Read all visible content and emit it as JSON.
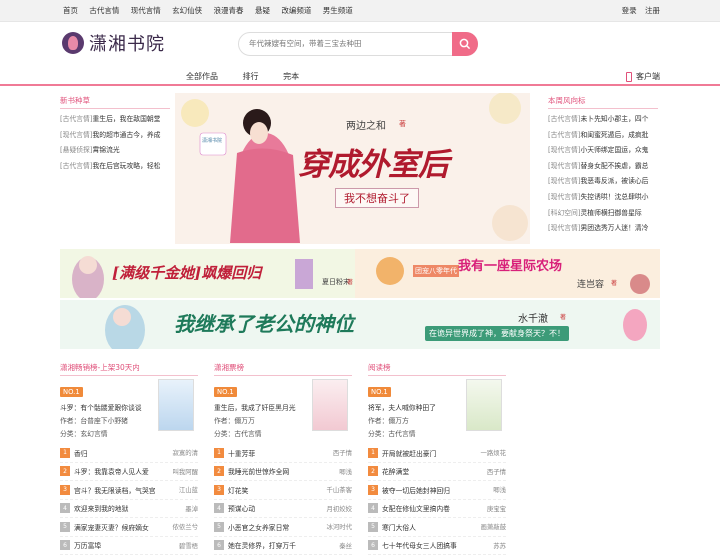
{
  "topbar": {
    "nav": [
      "首页",
      "古代言情",
      "现代言情",
      "玄幻仙侠",
      "浪漫青春",
      "悬疑",
      "改编频道",
      "男生频道"
    ],
    "login": "登录",
    "register": "注册"
  },
  "header": {
    "logo_text": "潇湘书院",
    "search_placeholder": "年代辣嫂有空间，带着三宝去种田"
  },
  "mainnav": {
    "items": [
      "全部作品",
      "排行",
      "完本"
    ],
    "service": "客户端"
  },
  "left": {
    "title": "新书种草",
    "items": [
      {
        "cat": "[古代言情]",
        "text": "重生后，我在敌国朝堂"
      },
      {
        "cat": "[现代言情]",
        "text": "我的超市通古今，养成"
      },
      {
        "cat": "[悬疑侦探]",
        "text": "霄锦流光"
      },
      {
        "cat": "[古代言情]",
        "text": "我在后宫玩攻略，轻松"
      }
    ]
  },
  "right": {
    "title": "本周风向标",
    "items": [
      {
        "cat": "[古代言情]",
        "text": "未卜先知小郡主，四个"
      },
      {
        "cat": "[古代言情]",
        "text": "和闺蜜死遁后，成疯批"
      },
      {
        "cat": "[现代言情]",
        "text": "小天师绑定国运，众鬼"
      },
      {
        "cat": "[现代言情]",
        "text": "替身女配不挨虐，霸总"
      },
      {
        "cat": "[现代言情]",
        "text": "我恶毒反派，被读心后"
      },
      {
        "cat": "[现代言情]",
        "text": "失控诱哄！沈总肆哄小"
      },
      {
        "cat": "[科幻空间]",
        "text": "灵植师横扫御兽星际"
      },
      {
        "cat": "[现代言情]",
        "text": "男团选秀万人迷！清冷"
      }
    ]
  },
  "banner": {
    "author": "两边之和",
    "author_suffix": "著",
    "title": "穿成外室后",
    "subtitle": "我不想奋斗了",
    "brand": "潇湘书院"
  },
  "ads": [
    {
      "title": "[满级千金她]飒爆回归",
      "author": "夏日粉末",
      "suffix": "著"
    },
    {
      "title": "我有一座星际农场",
      "prefix": "团宠八零年代",
      "author": "连岂容",
      "suffix": "著"
    },
    {
      "title": "我继承了老公的神位",
      "author": "水千澈",
      "suffix": "著",
      "subtitle": "在诡异世界成了神，要献身祭天？不！"
    }
  ],
  "ranks": [
    {
      "title": "潇湘畅销榜-上架30天内",
      "no1": {
        "badge": "NO.1",
        "name": "斗罗：有个骷髅爱跟你谈谈",
        "author": "作者：台普座下小野猪",
        "cat": "分类：玄幻言情"
      },
      "list": [
        {
          "t": "香归",
          "a": "寂寞的清"
        },
        {
          "t": "斗罗：我靠袁帝人见人爱",
          "a": "叫我阿醒"
        },
        {
          "t": "宫斗？我无限读档，气哭宫",
          "a": "江山蓝"
        },
        {
          "t": "欢迎来到我的地狱",
          "a": "墨淖"
        },
        {
          "t": "满家宠妻灭妻？候府嫡女",
          "a": "侬侬兰兮"
        },
        {
          "t": "万历富埠",
          "a": "碧雪梧"
        }
      ]
    },
    {
      "title": "潇湘票榜",
      "no1": {
        "badge": "NO.1",
        "name": "重生后，我成了奸臣黑月光",
        "author": "作者：儞万万",
        "cat": "分类：古代言情"
      },
      "list": [
        {
          "t": "十重芳菲",
          "a": "西子情"
        },
        {
          "t": "我睡光前世惊炸全网",
          "a": "唧浅"
        },
        {
          "t": "灯花笑",
          "a": "千山茶客"
        },
        {
          "t": "预谋心动",
          "a": "月初姣姣"
        },
        {
          "t": "小恶官之女养家日常",
          "a": "冰河时代"
        },
        {
          "t": "她在灵修界，打穿万千",
          "a": "秦丝"
        }
      ]
    },
    {
      "title": "阅读榜",
      "no1": {
        "badge": "NO.1",
        "name": "将军，夫人喊你种田了",
        "author": "作者：儞万方",
        "cat": "分类：古代言情"
      },
      "list": [
        {
          "t": "开局就被赶出豪门",
          "a": "一路烦花"
        },
        {
          "t": "花醉满堂",
          "a": "西子情"
        },
        {
          "t": "被夺一切后她封神回归",
          "a": "唧浅"
        },
        {
          "t": "女配在修仙文里搞内卷",
          "a": "庚宝宝"
        },
        {
          "t": "寒门大俗人",
          "a": "画萧敲鼓"
        },
        {
          "t": "七十年代母女三人团搞事",
          "a": "苏苏"
        }
      ]
    }
  ],
  "colors": {
    "accent": "#e0507a",
    "badge": "#f08a3a"
  }
}
